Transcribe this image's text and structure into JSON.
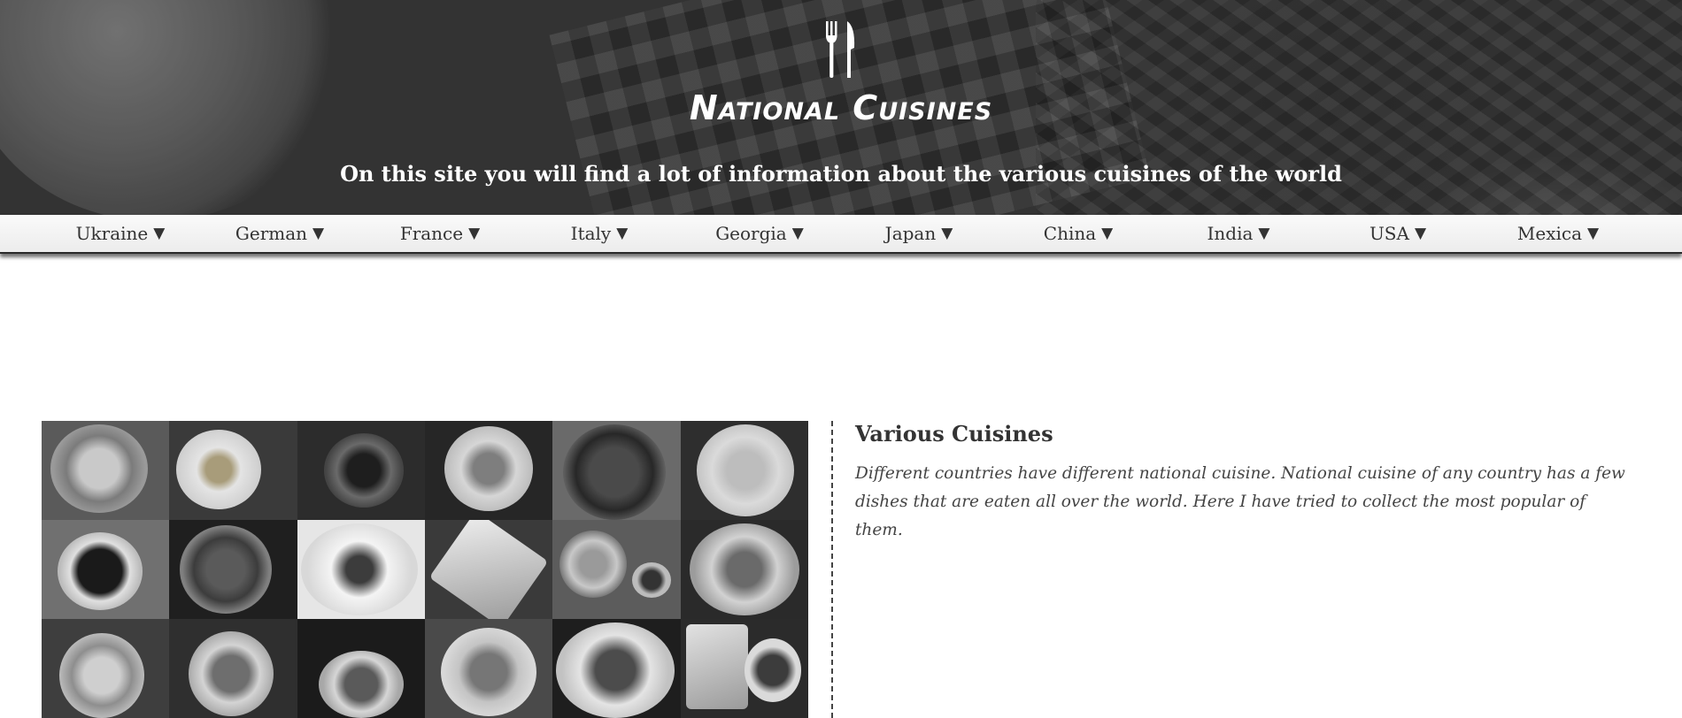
{
  "header": {
    "logo_icon": "fork-knife-icon",
    "title": "National Cuisines",
    "subtitle": "On this site you will find a lot of information about the various cuisines of the world"
  },
  "nav": {
    "items": [
      {
        "label": "Ukraine",
        "arrow": "▼"
      },
      {
        "label": "German",
        "arrow": "▼"
      },
      {
        "label": "France",
        "arrow": "▼"
      },
      {
        "label": "Italy",
        "arrow": "▼"
      },
      {
        "label": "Georgia",
        "arrow": "▼"
      },
      {
        "label": "Japan",
        "arrow": "▼"
      },
      {
        "label": "China",
        "arrow": "▼"
      },
      {
        "label": "India",
        "arrow": "▼"
      },
      {
        "label": "USA",
        "arrow": "▼"
      },
      {
        "label": "Mexica",
        "arrow": "▼"
      }
    ]
  },
  "content": {
    "title": "Various Cuisines",
    "text": "Different countries have different national cuisine. National cuisine of any country has a few dishes that are eaten all over the world. Here I have tried to collect the most popular of them."
  },
  "gallery": {
    "tiles": [
      "shellfish-dish",
      "skewer-plate",
      "dark-salad-bowl",
      "plated-fish",
      "mussel-pot",
      "pasta-plate",
      "dark-noodle-plate",
      "paella-pan",
      "steak-plate",
      "fish-platter",
      "soup-cup",
      "salmon-bowl",
      "ramen-bowl",
      "herb-soup",
      "grilled-meat",
      "round-patty",
      "meat-plate",
      "fries-steak"
    ]
  }
}
